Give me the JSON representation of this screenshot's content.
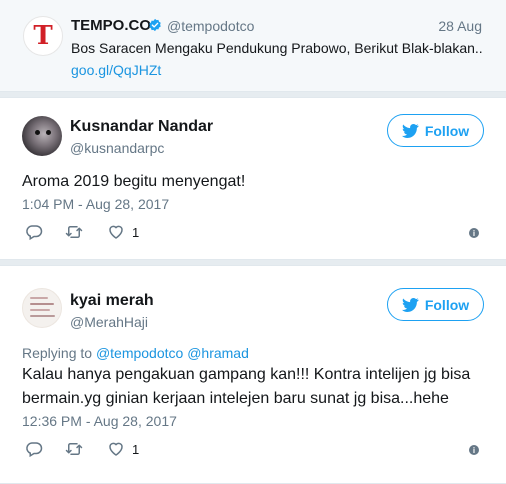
{
  "quoted_tweet": {
    "avatar_letter": "T",
    "name": "TEMPO.CO",
    "handle": "@tempodotco",
    "date": "28 Aug",
    "text": "Bos Saracen Mengaku Pendukung Prabowo, Berikut Blak-blakan..",
    "link": "goo.gl/QqJHZt"
  },
  "tweets": [
    {
      "name": "Kusnandar Nandar",
      "handle": "@kusnandarpc",
      "follow_label": "Follow",
      "text": "Aroma 2019 begitu menyengat!",
      "time": "1:04 PM - Aug 28, 2017",
      "like_count": "1"
    },
    {
      "name": "kyai merah",
      "handle": "@MerahHaji",
      "follow_label": "Follow",
      "replying_prefix": "Replying to",
      "replying_to_1": "@tempodotco",
      "replying_to_2": "@hramad",
      "text_line1": "Kalau hanya pengakuan gampang kan!!! Kontra intelijen jg bisa",
      "text_line2": "bermain.yg ginian kerjaan intelejen baru sunat jg bisa...hehe",
      "time": "12:36 PM - Aug 28, 2017",
      "like_count": "1"
    }
  ],
  "colors": {
    "twitter_blue": "#1da1f2",
    "link_blue": "#1b95e0",
    "muted": "#657786",
    "tempo_red": "#d12027"
  },
  "icons": {
    "verified": "verified-badge-icon",
    "follow": "twitter-bird-icon",
    "reply": "reply-icon",
    "retweet": "retweet-icon",
    "like": "heart-icon",
    "more": "info-icon"
  }
}
